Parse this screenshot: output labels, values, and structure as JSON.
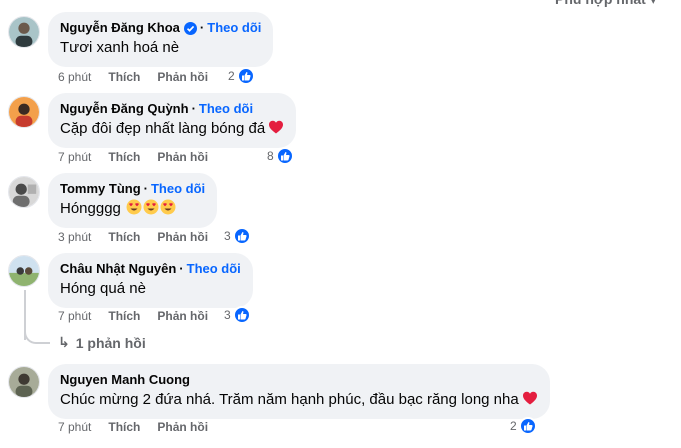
{
  "sort": {
    "label": "Phù hợp nhất ▾"
  },
  "comments": [
    {
      "name": "Nguyễn Đăng Khoa",
      "verified": true,
      "follow": "Theo dõi",
      "text": "Tươi xanh hoá nè",
      "time": "6 phút",
      "like": "Thích",
      "reply": "Phản hồi",
      "reactions": "2",
      "avatar_color": "#7fa0a6"
    },
    {
      "name": "Nguyễn Đăng Quỳnh",
      "verified": false,
      "follow": "Theo dõi",
      "text": "Cặp đôi đẹp nhất làng bóng đá",
      "emoji": "heart-emoji",
      "time": "7 phút",
      "like": "Thích",
      "reply": "Phản hồi",
      "reactions": "8",
      "avatar_color": "#e07b3a"
    },
    {
      "name": "Tommy Tùng",
      "verified": false,
      "follow": "Theo dõi",
      "text": "Hóngggg",
      "emoji": "heart-eyes-emoji",
      "time": "3 phút",
      "like": "Thích",
      "reply": "Phản hồi",
      "reactions": "3",
      "avatar_color": "#c9c9c9"
    },
    {
      "name": "Châu Nhật Nguyên",
      "verified": false,
      "follow": "Theo dõi",
      "text": "Hóng quá nè",
      "time": "7 phút",
      "like": "Thích",
      "reply": "Phản hồi",
      "reactions": "3",
      "avatar_color": "#9fbf8a",
      "replies_link": "1 phản hồi"
    },
    {
      "name": "Nguyen Manh Cuong",
      "verified": false,
      "follow": "",
      "text": "Chúc mừng 2 đứa nhá. Trăm năm hạnh phúc, đầu bạc răng long nha",
      "emoji": "heart-emoji",
      "time": "7 phút",
      "like": "Thích",
      "reply": "Phản hồi",
      "reactions": "2",
      "avatar_color": "#8a8f7e"
    }
  ],
  "colors": {
    "accent": "#0866ff",
    "bubble": "#f0f2f5",
    "muted": "#65676b",
    "heart": "#e41e3f"
  },
  "dot": "·"
}
